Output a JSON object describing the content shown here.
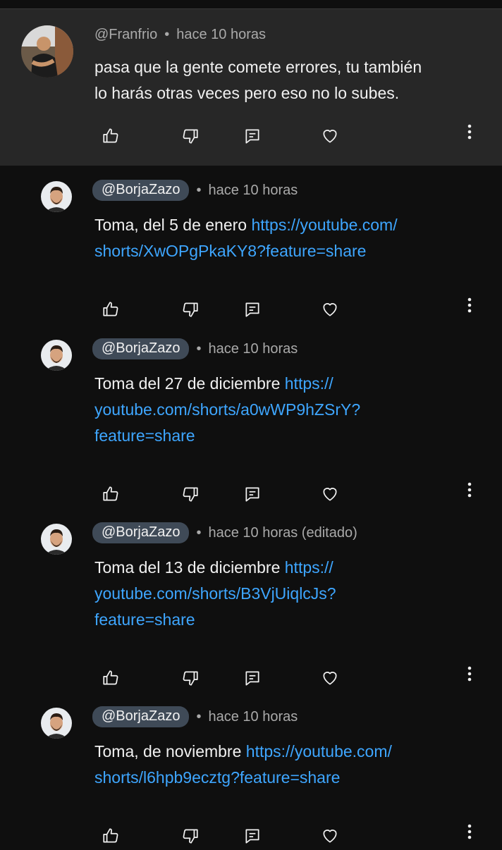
{
  "parent_comment": {
    "handle": "@Franfrio",
    "time": "hace 10 horas",
    "text_line1": "pasa que la gente comete errores, tu también",
    "text_line2": "lo harás otras veces pero eso no lo subes."
  },
  "replies": [
    {
      "handle": "@BorjaZazo",
      "time": "hace 10 horas",
      "text_lines": [
        "Toma, del 5 de enero ",
        "https://youtube.com/",
        "shorts/XwOPgPkaKY8?feature=share"
      ]
    },
    {
      "handle": "@BorjaZazo",
      "time": "hace 10 horas",
      "text_lines": [
        "Toma del 27 de diciembre ",
        "https://",
        "youtube.com/shorts/a0wWP9hZSrY?",
        "feature=share"
      ]
    },
    {
      "handle": "@BorjaZazo",
      "time": "hace 10 horas (editado)",
      "text_lines": [
        "Toma del 13 de diciembre ",
        "https://",
        "youtube.com/shorts/B3VjUiqlcJs?",
        "feature=share"
      ]
    },
    {
      "handle": "@BorjaZazo",
      "time": "hace 10 horas",
      "text_lines": [
        "Toma, de noviembre ",
        "https://youtube.com/",
        "shorts/l6hpb9ecztg?feature=share"
      ]
    }
  ],
  "separator": "•",
  "icons": {
    "like": "thumbs-up-icon",
    "dislike": "thumbs-down-icon",
    "reply": "comment-reply-icon",
    "heart": "heart-icon",
    "more": "more-vert-icon"
  },
  "colors": {
    "background": "#0f0f0f",
    "parent_background": "#272727",
    "link": "#3ea6ff",
    "chip": "#3f4a57",
    "secondary_text": "#aaaaaa"
  }
}
